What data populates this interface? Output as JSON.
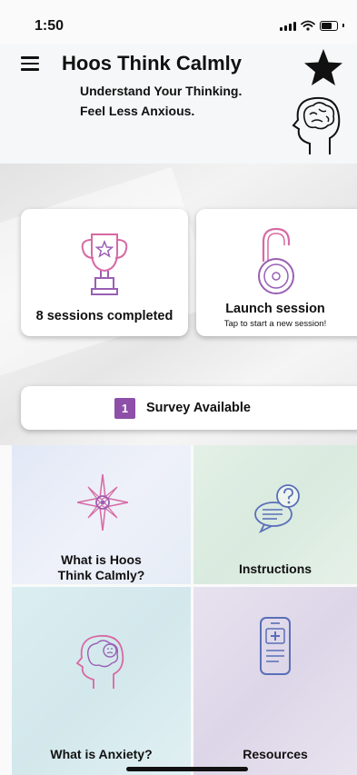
{
  "status": {
    "time": "1:50"
  },
  "header": {
    "title": "Hoos Think Calmly",
    "tagline_line1": "Understand Your Thinking.",
    "tagline_line2": "Feel Less Anxious."
  },
  "cards": {
    "sessions_label": "8 sessions completed",
    "launch_label": "Launch session",
    "launch_sub": "Tap to start a new session!"
  },
  "survey": {
    "count": "1",
    "label": "Survey Available"
  },
  "tiles": {
    "what_line1": "What is Hoos",
    "what_line2": "Think Calmly?",
    "instructions": "Instructions",
    "anxiety": "What is Anxiety?",
    "resources": "Resources"
  },
  "icons": {
    "menu": "hamburger-icon",
    "favorite": "star-icon",
    "mind": "head-brain-icon",
    "sessions": "trophy-icon",
    "launch": "unlocked-padlock-icon",
    "about": "compass-star-icon",
    "instructions": "chat-question-icon",
    "anxiety": "anxious-head-icon",
    "resources": "phone-document-icon"
  },
  "colors": {
    "accent_purple": "#8d4fa8",
    "icon_pink": "#d66aa4",
    "icon_purple": "#9a5fb4",
    "icon_blue": "#5a6fb8"
  }
}
